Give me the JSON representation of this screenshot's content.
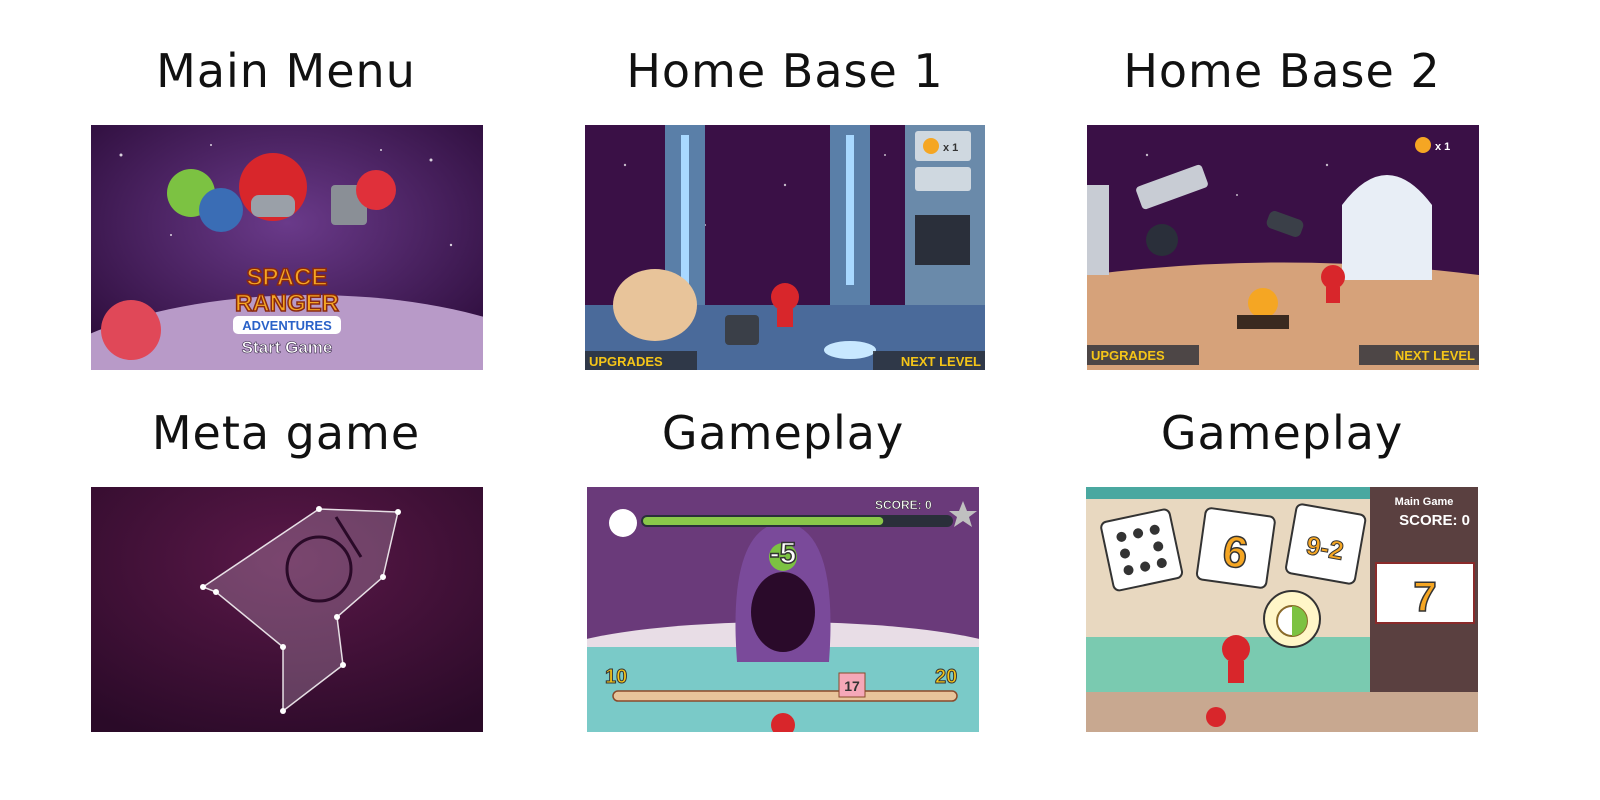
{
  "panels": {
    "main_menu": {
      "title": "Main Menu",
      "logo_line1": "SPACE",
      "logo_line2": "RANGER",
      "logo_line3": "ADVENTURES",
      "start_label": "Start Game"
    },
    "home_base_1": {
      "title": "Home Base 1",
      "badge_count": "x 1",
      "upgrades_label": "UPGRADES",
      "next_level_label": "NEXT LEVEL"
    },
    "home_base_2": {
      "title": "Home Base 2",
      "badge_count": "x 1",
      "upgrades_label": "UPGRADES",
      "next_level_label": "NEXT LEVEL"
    },
    "meta_game": {
      "title": "Meta game"
    },
    "gameplay_1": {
      "title": "Gameplay",
      "score_label": "SCORE: 0",
      "monster_value": "-5",
      "range_min": "10",
      "range_max": "20",
      "current_value": "17",
      "health_fraction": 0.78
    },
    "gameplay_2": {
      "title": "Gameplay",
      "mode_label": "Main Game",
      "score_label": "SCORE: 0",
      "card_2_value": "6",
      "card_3_value": "9-2",
      "answer_value": "7"
    }
  },
  "colors": {
    "space_purple": "#3a1046",
    "next_level_yellow": "#f5c518",
    "hero_red": "#d8262b"
  }
}
